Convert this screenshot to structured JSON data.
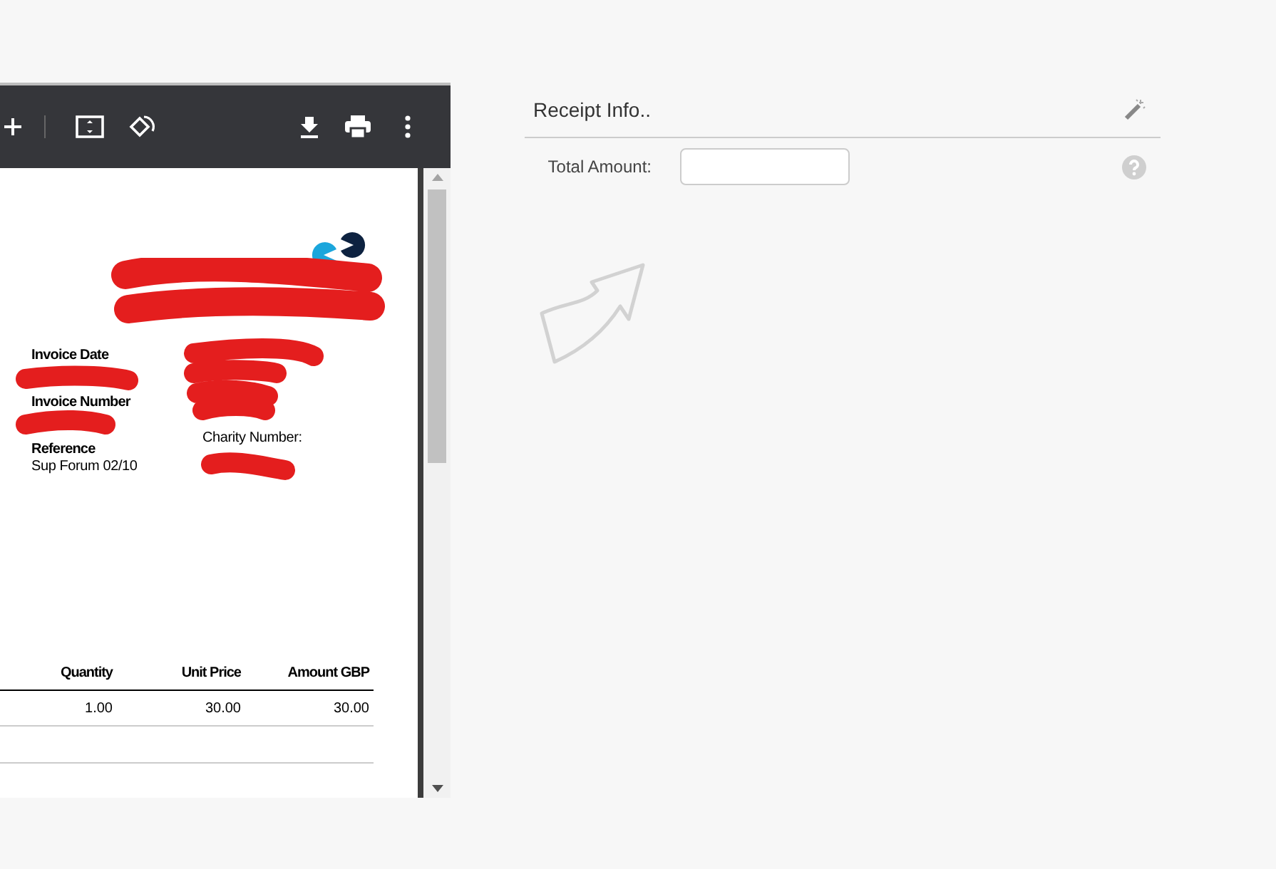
{
  "pdf_document": {
    "info_left": [
      {
        "label": "Invoice Date"
      },
      {
        "label": "Invoice Number"
      },
      {
        "label": "Reference",
        "value": "Sup Forum 02/10"
      }
    ],
    "info_right": [
      {
        "label": "Charity Number:"
      }
    ],
    "table": {
      "columns": [
        "Quantity",
        "Unit Price",
        "Amount GBP"
      ],
      "rows": [
        [
          "1.00",
          "30.00",
          "30.00"
        ]
      ]
    }
  },
  "receipt_panel": {
    "title": "Receipt Info..",
    "fields": [
      {
        "label": "Total Amount:"
      }
    ]
  }
}
